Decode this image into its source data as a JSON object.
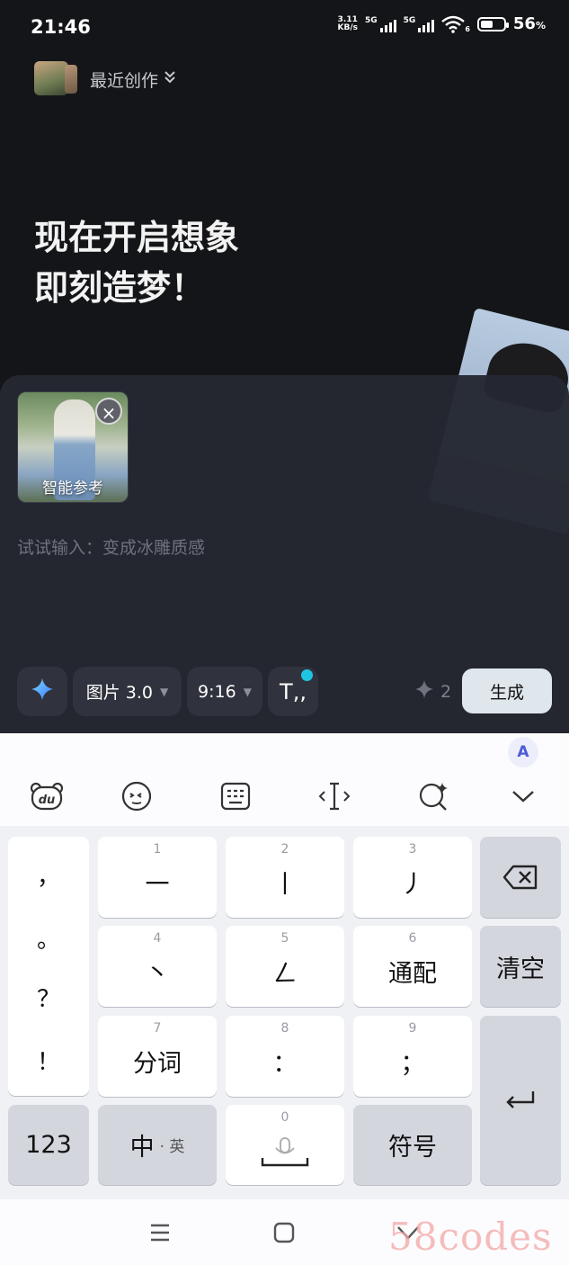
{
  "status_bar": {
    "time": "21:46",
    "net_speed_value": "3.11",
    "net_speed_unit": "KB/s",
    "signal1_label": "5G",
    "signal2_label": "5G",
    "wifi_badge": "6",
    "battery_percent": "56",
    "battery_unit": "%",
    "battery_level": 0.56
  },
  "header": {
    "recent_label": "最近创作"
  },
  "headline": {
    "line1": "现在开启想象",
    "line2": "即刻造梦！"
  },
  "reference_card": {
    "label": "智能参考",
    "close_symbol": "×"
  },
  "prompt": {
    "placeholder": "试试输入：变成冰雕质感"
  },
  "toolbar": {
    "sparkle_icon": "sparkle-icon",
    "model_label": "图片 3.0",
    "ratio_label": "9:16",
    "text_style_label": "T,,",
    "credits_count": "2",
    "generate_label": "生成"
  },
  "keyboard": {
    "ai_badge": "A",
    "tools": [
      "du",
      "☺",
      "⌨",
      "‹I›",
      "Q",
      "⌄"
    ],
    "punctuation": [
      "，",
      "。",
      "？",
      "！"
    ],
    "keys": [
      {
        "num": "1",
        "label": "一"
      },
      {
        "num": "2",
        "label": "丨"
      },
      {
        "num": "3",
        "label": "丿"
      },
      {
        "num": "4",
        "label": "丶"
      },
      {
        "num": "5",
        "label": "ㄥ"
      },
      {
        "num": "6",
        "label": "通配"
      },
      {
        "num": "7",
        "label": "分词"
      },
      {
        "num": "8",
        "label": "："
      },
      {
        "num": "9",
        "label": "；"
      }
    ],
    "backspace": "⌫",
    "clear": "清空",
    "enter": "↵",
    "numbers_key": "123",
    "lang_key_main": "中",
    "lang_key_sub": "· 英",
    "space_num": "0",
    "symbols_key": "符号"
  },
  "nav_bar": {
    "menu": "☰",
    "home": "▢",
    "back": "∨"
  },
  "watermark": "58codes"
}
